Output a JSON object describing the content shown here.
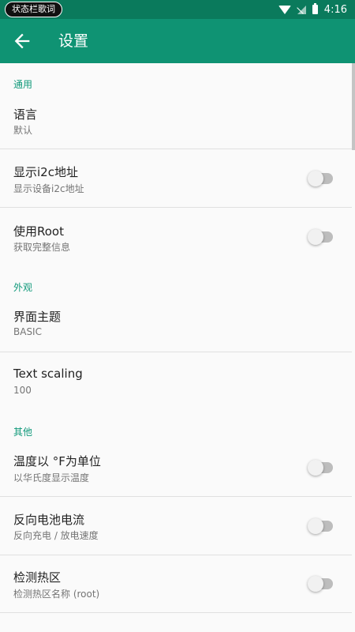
{
  "status_bar": {
    "pill_label": "状态栏歌词",
    "time": "4:16",
    "icons": [
      "wifi-icon",
      "no-sim-icon",
      "battery-icon"
    ]
  },
  "app_bar": {
    "title": "设置",
    "back_icon": "arrow-left-icon"
  },
  "colors": {
    "status_bar": "#0a7a5c",
    "app_bar": "#0f9373",
    "accent": "#10997a",
    "background": "#fafafa"
  },
  "sections": [
    {
      "header": "通用",
      "items": [
        {
          "title": "语言",
          "subtitle": "默认"
        },
        {
          "title": "显示i2c地址",
          "subtitle": "显示设备i2c地址",
          "switch_on": false
        },
        {
          "title": "使用Root",
          "subtitle": "获取完整信息",
          "switch_on": false
        }
      ]
    },
    {
      "header": "外观",
      "items": [
        {
          "title": "界面主题",
          "subtitle": "BASIC"
        },
        {
          "title": "Text scaling",
          "subtitle": "100"
        }
      ]
    },
    {
      "header": "其他",
      "items": [
        {
          "title": "温度以 °F为单位",
          "subtitle": "以华氏度显示温度",
          "switch_on": false
        },
        {
          "title": "反向电池电流",
          "subtitle": "反向充电 / 放电速度",
          "switch_on": false
        },
        {
          "title": "检测热区",
          "subtitle": "检测热区名称 (root)",
          "switch_on": false
        }
      ]
    }
  ]
}
